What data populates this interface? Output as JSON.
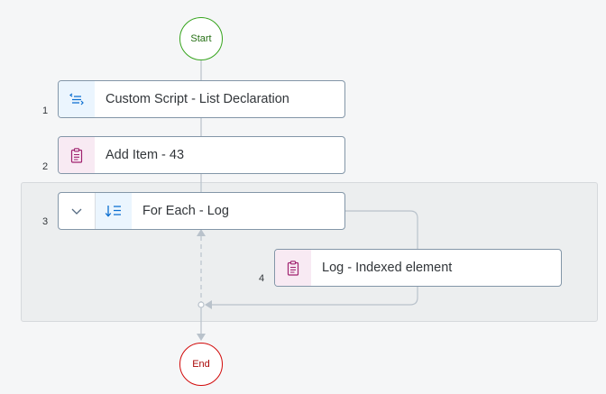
{
  "nodes": {
    "start_label": "Start",
    "end_label": "End"
  },
  "steps": [
    {
      "number": "1",
      "label": "Custom Script - List Declaration",
      "icon": "script-icon"
    },
    {
      "number": "2",
      "label": "Add Item - 43",
      "icon": "clipboard-icon"
    },
    {
      "number": "3",
      "label": "For Each - Log",
      "icon": "loop-icon"
    },
    {
      "number": "4",
      "label": "Log - Indexed element",
      "icon": "clipboard-icon"
    }
  ],
  "colors": {
    "start": "#36a41d",
    "end": "#d20a0a",
    "script_accent": "#0a6ed1",
    "item_accent": "#a0226f"
  }
}
